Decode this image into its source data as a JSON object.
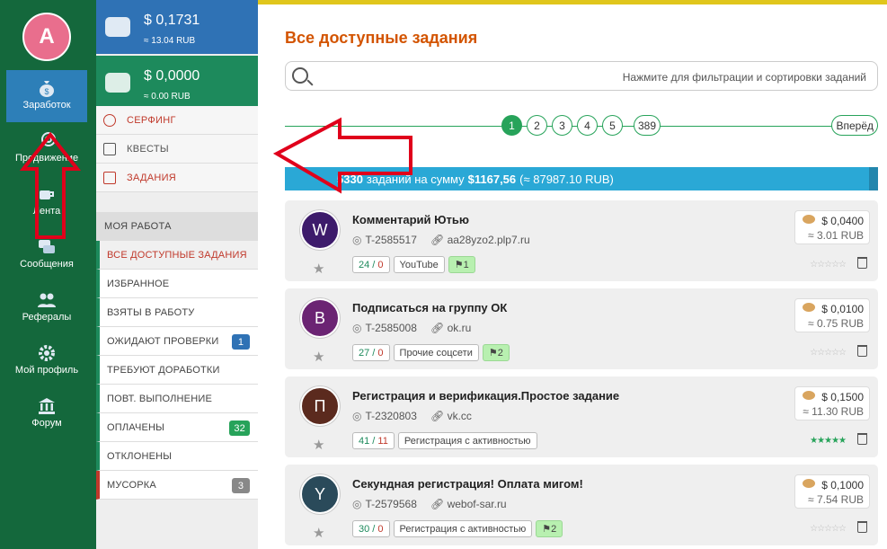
{
  "user": {
    "avatar_letter": "A"
  },
  "rail": [
    {
      "label": "Заработок",
      "icon": "money-bag-icon",
      "active": true
    },
    {
      "label": "Продвижение",
      "icon": "target-arrow-icon"
    },
    {
      "label": "Лента",
      "icon": "coffee-icon"
    },
    {
      "label": "Сообщения",
      "icon": "chat-icon"
    },
    {
      "label": "Рефералы",
      "icon": "users-icon"
    },
    {
      "label": "Мой профиль",
      "icon": "gear-icon"
    },
    {
      "label": "Форум",
      "icon": "bank-icon"
    }
  ],
  "wallets": [
    {
      "usd": "$ 0,1731",
      "rub": "≈ 13.04 RUB",
      "icon": "wallet-icon"
    },
    {
      "usd": "$ 0,0000",
      "rub": "≈ 0.00 RUB",
      "icon": "cash-icon"
    }
  ],
  "menu_top": [
    {
      "label": "СЕРФИНГ",
      "icon": "clock-icon"
    },
    {
      "label": "КВЕСТЫ",
      "icon": "puzzle-icon"
    },
    {
      "label": "ЗАДАНИЯ",
      "icon": "briefcase-icon"
    }
  ],
  "section_title": "МОЯ РАБОТА",
  "menu_work": [
    {
      "label": "ВСЕ ДОСТУПНЫЕ ЗАДАНИЯ",
      "badge": ""
    },
    {
      "label": "ИЗБРАННОЕ",
      "badge": ""
    },
    {
      "label": "ВЗЯТЫ В РАБОТУ",
      "badge": ""
    },
    {
      "label": "ОЖИДАЮТ ПРОВЕРКИ",
      "badge": "1"
    },
    {
      "label": "ТРЕБУЮТ ДОРАБОТКИ",
      "badge": ""
    },
    {
      "label": "ПОВТ. ВЫПОЛНЕНИЕ",
      "badge": ""
    },
    {
      "label": "ОПЛАЧЕНЫ",
      "badge": "32"
    },
    {
      "label": "ОТКЛОНЕНЫ",
      "badge": ""
    },
    {
      "label": "МУСОРКА",
      "badge": "3"
    }
  ],
  "page_title": "Все доступные задания",
  "search": {
    "placeholder": "Нажмите для фильтрации и сортировки заданий"
  },
  "pagination": {
    "pages": [
      "1",
      "2",
      "3",
      "4",
      "5",
      "389"
    ],
    "current": "1",
    "next": "Вперёд"
  },
  "summary": {
    "count": "5330",
    "text1": "заданий на сумму",
    "amount": "$1167,56",
    "rub": "(≈ 87987.10 RUB)"
  },
  "tasks": [
    {
      "letter": "W",
      "color": "#3d1b6b",
      "title": "Комментарий Ютью",
      "id": "T-2585517",
      "link": "aa28yzo2.plp7.ru",
      "done": "24",
      "rejected": "0",
      "category": "YouTube",
      "flag": "1",
      "price_usd": "$ 0,0400",
      "price_rub": "≈ 3.01 RUB",
      "rating": "☆☆☆☆☆",
      "rated": false
    },
    {
      "letter": "B",
      "color": "#6b2473",
      "title": "Подписаться на группу ОК",
      "id": "T-2585008",
      "link": "ok.ru",
      "done": "27",
      "rejected": "0",
      "category": "Прочие соцсети",
      "flag": "2",
      "price_usd": "$ 0,0100",
      "price_rub": "≈ 0.75 RUB",
      "rating": "☆☆☆☆☆",
      "rated": false
    },
    {
      "letter": "П",
      "color": "#5b2a1e",
      "title": "Регистрация и верификация.Простое задание",
      "id": "T-2320803",
      "link": "vk.cc",
      "done": "41",
      "rejected": "11",
      "category": "Регистрация с активностью",
      "flag": "",
      "price_usd": "$ 0,1500",
      "price_rub": "≈ 11.30 RUB",
      "rating": "★★★★★",
      "rated": true
    },
    {
      "letter": "Y",
      "color": "#2a4a5a",
      "title": "Секундная регистрация! Оплата мигом!",
      "id": "T-2579568",
      "link": "webof-sar.ru",
      "done": "30",
      "rejected": "0",
      "category": "Регистрация с активностью",
      "flag": "2",
      "price_usd": "$ 0,1000",
      "price_rub": "≈ 7.54 RUB",
      "rating": "☆☆☆☆☆",
      "rated": false
    }
  ],
  "colors": {
    "rail": "#14683c",
    "accent": "#27a35a",
    "title": "#d35400",
    "annotation": "#e0001b"
  }
}
